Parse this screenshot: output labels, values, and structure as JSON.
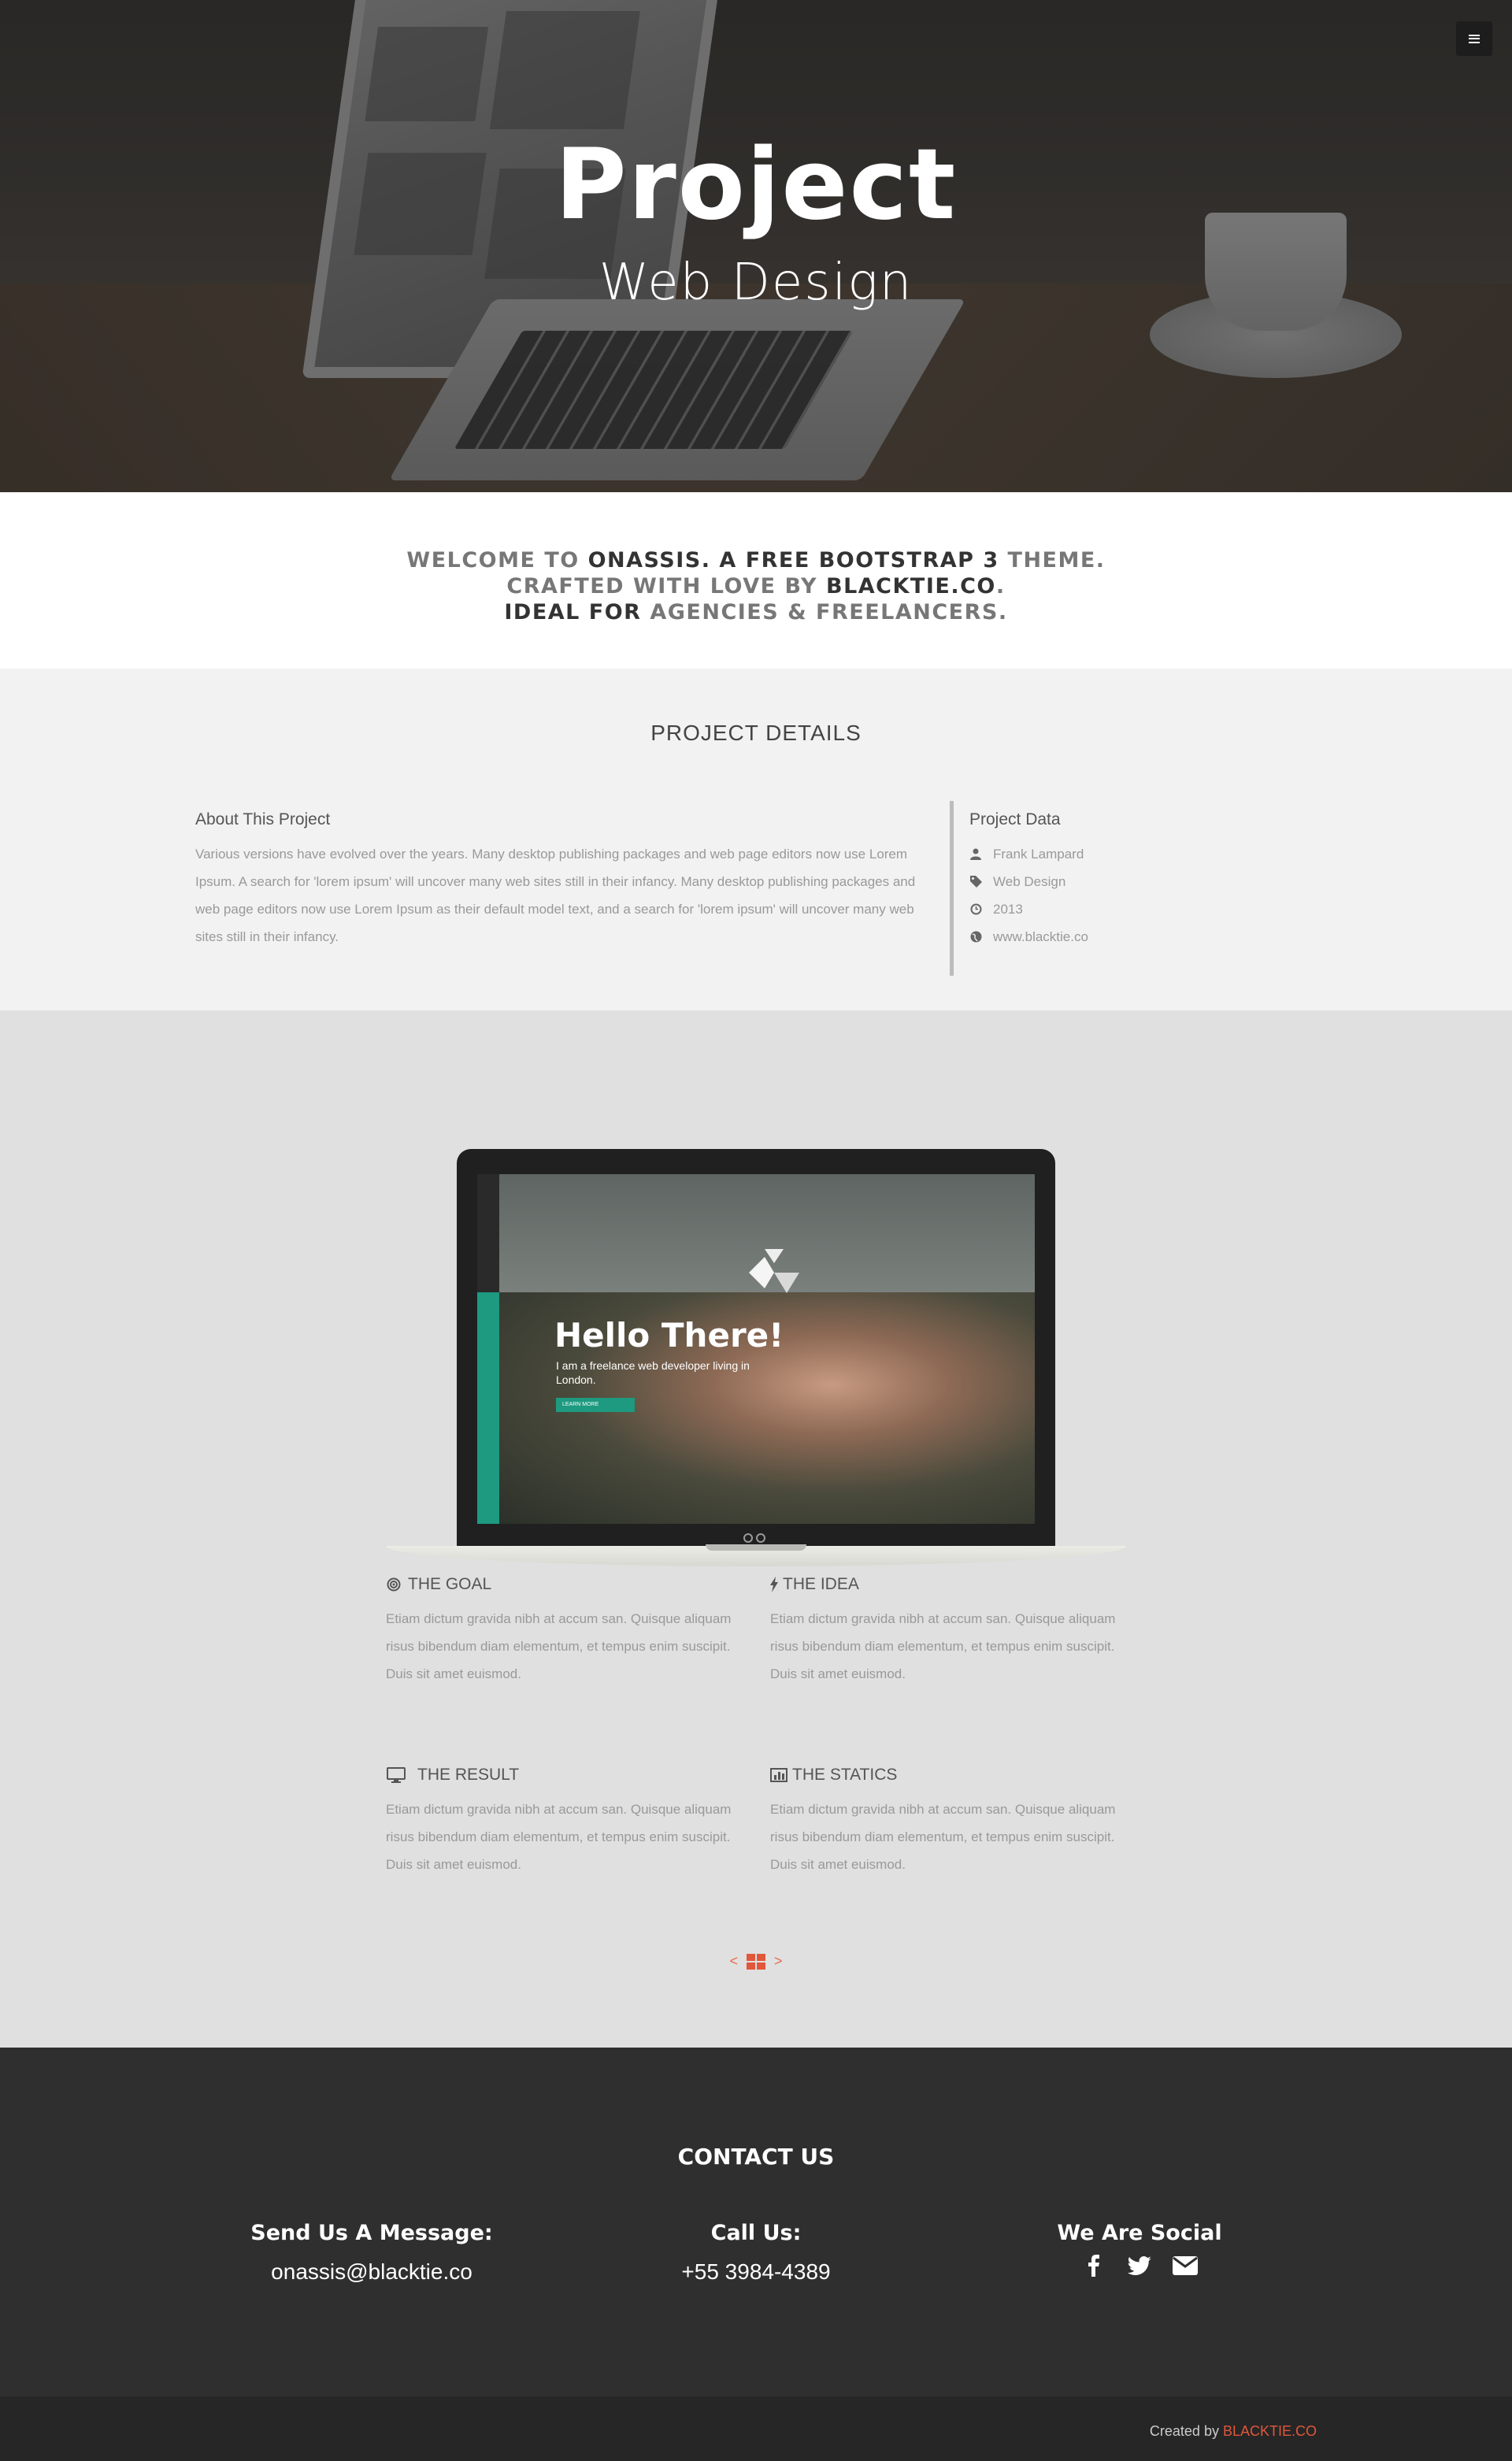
{
  "hero": {
    "title": "Project",
    "subtitle": "Web Design",
    "menu_icon": "menu-icon"
  },
  "welcome": {
    "line1_pre": "WELCOME TO ",
    "line1_bold1": "ONASSIS",
    "line1_mid": ". A ",
    "line1_bold2": "FREE BOOTSTRAP 3",
    "line1_post": " THEME.",
    "line2_pre": "CRAFTED WITH LOVE BY ",
    "line2_bold": "BLACKTIE.CO",
    "line2_post": ".",
    "line3_bold": "IDEAL FOR",
    "line3_post": " AGENCIES & FREELANCERS."
  },
  "details": {
    "title": "PROJECT DETAILS",
    "about_heading": "About This Project",
    "about_text": "Various versions have evolved over the years. Many desktop publishing packages and web page editors now use Lorem Ipsum. A search for 'lorem ipsum' will uncover many web sites still in their infancy. Many desktop publishing packages and web page editors now use Lorem Ipsum as their default model text, and a search for 'lorem ipsum' will uncover many web sites still in their infancy.",
    "data_heading": "Project Data",
    "data_items": [
      {
        "icon": "user-icon",
        "text": "Frank Lampard"
      },
      {
        "icon": "tag-icon",
        "text": "Web Design"
      },
      {
        "icon": "clock-icon",
        "text": "2013"
      },
      {
        "icon": "globe-icon",
        "text": "www.blacktie.co"
      }
    ]
  },
  "showcase": {
    "hello": "Hello There!",
    "hello_sub": "I am a freelance web developer living in London.",
    "learn_more": "LEARN MORE"
  },
  "features": [
    {
      "icon": "target-icon",
      "title": "THE GOAL",
      "text": "Etiam dictum gravida nibh at accum san. Quisque aliquam risus bibendum diam elementum, et tempus enim suscipit. Duis sit amet euismod."
    },
    {
      "icon": "bolt-icon",
      "title": "THE IDEA",
      "text": "Etiam dictum gravida nibh at accum san. Quisque aliquam risus bibendum diam elementum, et tempus enim suscipit. Duis sit amet euismod."
    },
    {
      "icon": "desktop-icon",
      "title": "THE RESULT",
      "text": "Etiam dictum gravida nibh at accum san. Quisque aliquam risus bibendum diam elementum, et tempus enim suscipit. Duis sit amet euismod."
    },
    {
      "icon": "bar-chart-icon",
      "title": "THE STATICS",
      "text": "Etiam dictum gravida nibh at accum san. Quisque aliquam risus bibendum diam elementum, et tempus enim suscipit. Duis sit amet euismod."
    }
  ],
  "pager": {
    "prev": "<",
    "next": ">"
  },
  "contact": {
    "title": "CONTACT US",
    "message_heading": "Send Us A Message:",
    "email": "onassis@blacktie.co",
    "call_heading": "Call Us:",
    "phone": "+55 3984-4389",
    "social_heading": "We Are Social",
    "social_icons": [
      "facebook-icon",
      "twitter-icon",
      "envelope-icon"
    ]
  },
  "footer": {
    "credit_pre": "Created by ",
    "credit_link": "BLACKTIE.CO"
  },
  "colors": {
    "accent": "#e0573b",
    "teal": "#1d9a80",
    "dark": "#2f2f2f",
    "footer": "#262626"
  }
}
